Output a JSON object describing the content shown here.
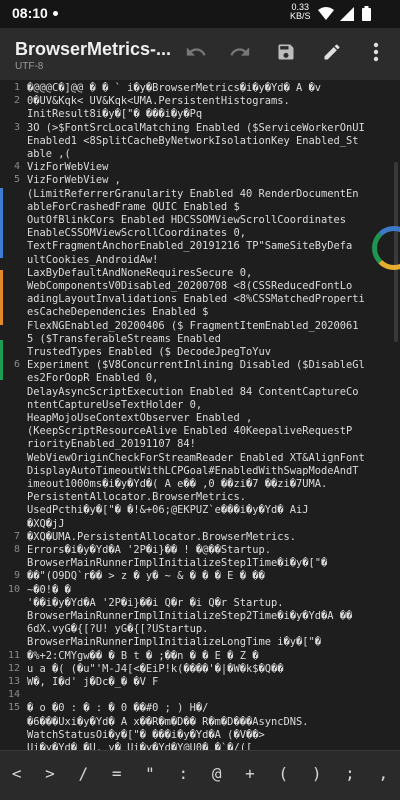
{
  "status_bar": {
    "time": "08:10",
    "net_speed_value": "0.33",
    "net_speed_unit": "KB/S",
    "icons": [
      "notification-dot",
      "wifi-icon",
      "signal-icon",
      "battery-icon"
    ]
  },
  "app_bar": {
    "title": "BrowserMetrics-...",
    "subtitle": "UTF-8",
    "actions": [
      "undo-icon",
      "redo-icon",
      "save-icon",
      "edit-icon",
      "more-vert-icon"
    ]
  },
  "editor": {
    "line_numbers": [
      "1",
      "2",
      "3",
      "4",
      "5",
      "6",
      "7",
      "8",
      "9",
      "10",
      "11",
      "12",
      "13",
      "14",
      "15"
    ],
    "rows": [
      "�@@@C�]@@ � � ` i�y�BrowserMetrics�i�y�Yd� A �v",
      "0�UV&Kqk< UV&Kqk<UMA.PersistentHistograms.",
      "InitResult8i�y�[\"� ���i�y�Pq",
      "3O (>$FontSrcLocalMatching Enabled ($ServiceWorkerOnUI",
      "Enabled1 <8SplitCacheByNetworkIsolationKey Enabled_St",
      "able ,(",
      "VizForWebView",
      "VizForWebView ,",
      "(LimitReferrerGranularity Enabled 40 RenderDocumentEn",
      "ableForCrashedFrame  QUIC Enabled $",
      "OutOfBlinkCors Enabled HDCSSOMViewScrollCoordinates",
      "EnableCSSOMViewScrollCoordinates 0,",
      "TextFragmentAnchorEnabled_20191216 TP\"SameSiteByDefa",
      "ultCookies_AndroidAw!",
      "LaxByDefaultAndNoneRequiresSecure 0,",
      "WebComponentsV0Disabled_20200708 <8(CSSReducedFontLo",
      "adingLayoutInvalidations Enabled <8%CSSMatchedProperti",
      "esCacheDependencies Enabled $",
      "FlexNGEnabled_20200406 ($ FragmentItemEnabled_2020061",
      "5 ($TransferableStreams Enabled",
      "TrustedTypes Enabled ($ DecodeJpegToYuv",
      "Experiment ($V8ConcurrentInlining Disabled ($DisableGl",
      "es2ForOopR Enabled 0,",
      "DelayAsyncScriptExecution Enabled 84 ContentCaptureCo",
      "ntentCaptureUseTextHolder 0,",
      "HeapMojoUseContextObserver Enabled ,",
      "(KeepScriptResourceAlive Enabled 40KeepaliveRequestP",
      "riorityEnabled_20191107 84!",
      "WebViewOriginCheckForStreamReader Enabled XT&AlignFont",
      "DisplayAutoTimeoutWithLCPGoal#EnabledWithSwapModeAndT",
      "imeout1000ms�i�y�Yd�( A e�� ,0 ��zi�7 ��zi�7UMA.",
      "PersistentAllocator.BrowserMetrics.",
      "UsedPcthi�y�[\"� �!&+06;@EKPUZ`e���i�y�Yd� AiJ",
      "�XQ�jJ",
      "�XQ�UMA.PersistentAllocator.BrowserMetrics.",
      "Errors�i�y�Yd�A '2P�i}�� !  �@��Startup.",
      "BrowserMainRunnerImplInitializeStep1Time�i�y�[\"�",
      "��\"(O9DQ`r�� > z � y� ~ & � � � E �   ��",
      "~�0!�  �",
      "'��i�y�Yd�A '2P�i}��i Q�r  �i Q�r Startup.",
      "BrowserMainRunnerImplInitializeStep2Time�i�y�Yd�A ��",
      "6dX.vyG�{[?U!  yG�{[?UStartup.",
      "BrowserMainRunnerImplInitializeLongTime  i�y�[\"�",
      "  �%+2:CMYgw�� � B t  �  ;��n � � E �  Z  �",
      "u a �( (�u\"'M-J4[<�EiP!k(����'�|�W�k$�Q��",
      "W�, I�d' j�Dc�_�  �V F",
      "",
      "� o �0 : � : � 0 ��#0 ; ) H�/",
      "�6���Uxi�y�Yd� A x��R�m�D�� R�m�D���AsyncDNS.",
      "WatchStatusOi�y�[\"� ���i�y�Yd�A (�V��>",
      "Ui�y�Yd� �U. y�  Ui�y�Yd�Y@U0� �`�/(["
    ]
  },
  "symbol_bar": {
    "keys": [
      "<",
      ">",
      "/",
      "=",
      "\"",
      ":",
      "@",
      "+",
      "(",
      ")",
      ";",
      ","
    ]
  },
  "accent_colors": {
    "edge_blue": "#3f7ecf",
    "edge_orange": "#e08a2b",
    "edge_green": "#1f9d55",
    "edge_red": "#d64b3b"
  }
}
